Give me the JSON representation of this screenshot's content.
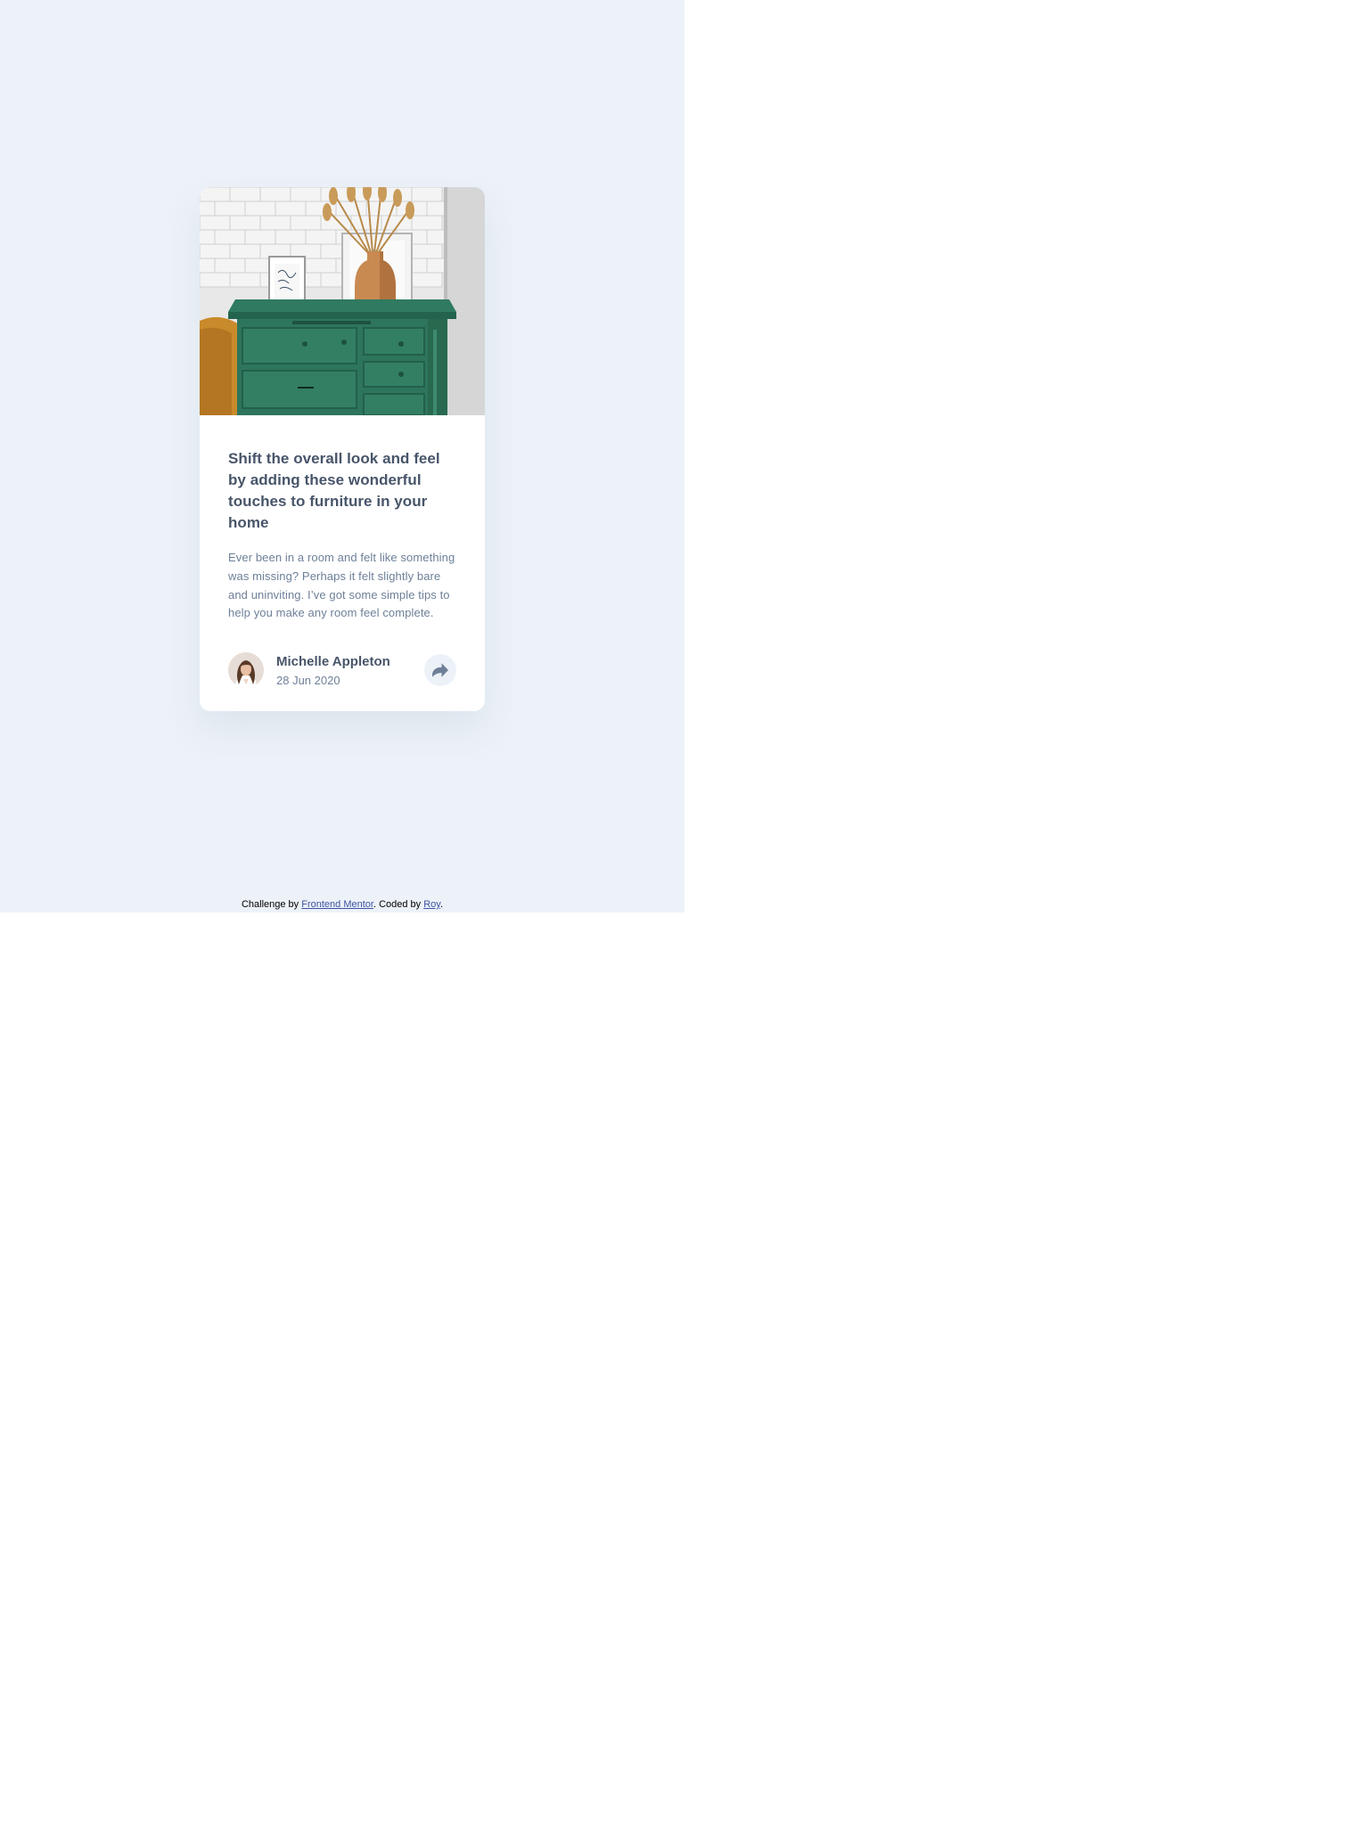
{
  "colors": {
    "page_background": "#ecf2f8",
    "outside_background": "#ffffff",
    "card_background": "#ffffff",
    "heading": "#48556a",
    "body_text": "#6e8098",
    "link": "#3e52a3",
    "share_button_background": "#ecf2f8"
  },
  "card": {
    "image_description_icon": "drawers-photo",
    "title": "Shift the overall look and feel by adding these wonderful touches to furniture in your home",
    "description": "Ever been in a room and felt like something was missing? Perhaps it felt slightly bare and uninviting. I’ve got some simple tips to help you make any room feel complete.",
    "author": {
      "name": "Michelle Appleton",
      "date": "28 Jun 2020",
      "avatar_icon": "avatar-portrait"
    },
    "share_icon": "share-icon"
  },
  "attribution": {
    "prefix": "Challenge by ",
    "frontend_mentor_link": "Frontend Mentor",
    "middle": ". Coded by ",
    "author_link": "Roy",
    "suffix": "."
  }
}
